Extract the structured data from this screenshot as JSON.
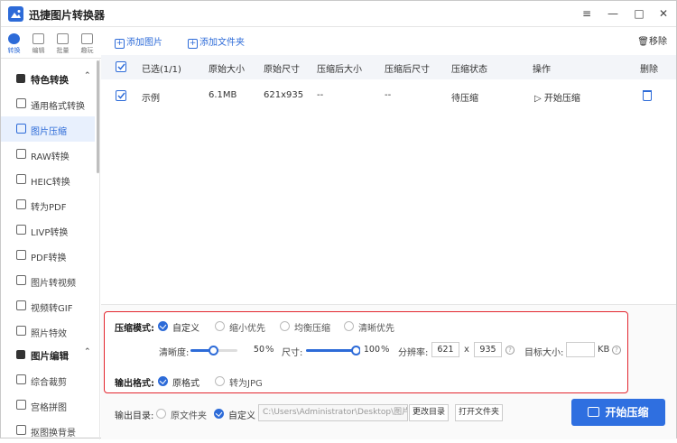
{
  "app": {
    "title": "迅捷图片转换器",
    "brand_color": "#2d6bd8"
  },
  "window_controls": {
    "menu": "≡",
    "minimize": "—",
    "maximize": "□",
    "close": "✕"
  },
  "nav_tabs": [
    {
      "label": "转换",
      "icon": "convert-icon",
      "active": true
    },
    {
      "label": "编辑",
      "icon": "edit-icon"
    },
    {
      "label": "批量",
      "icon": "batch-icon"
    },
    {
      "label": "趣玩",
      "icon": "fun-icon"
    }
  ],
  "sidebar": {
    "group1": {
      "label": "特色转换",
      "chevron": "⌃"
    },
    "items": [
      {
        "label": "通用格式转换"
      },
      {
        "label": "图片压缩",
        "active": true
      },
      {
        "label": "RAW转换"
      },
      {
        "label": "HEIC转换"
      },
      {
        "label": "转为PDF"
      },
      {
        "label": "LIVP转换"
      },
      {
        "label": "PDF转换"
      },
      {
        "label": "图片转视频"
      },
      {
        "label": "视频转GIF"
      },
      {
        "label": "照片特效"
      }
    ],
    "group2": {
      "label": "图片编辑",
      "chevron": "⌃"
    },
    "items2": [
      {
        "label": "综合裁剪"
      },
      {
        "label": "宫格拼图"
      },
      {
        "label": "抠图换背景"
      }
    ]
  },
  "toolbar": {
    "add_image": "添加图片",
    "add_folder": "添加文件夹",
    "remove": "移除"
  },
  "table": {
    "headers": [
      "已选(1/1)",
      "原始大小",
      "原始尺寸",
      "压缩后大小",
      "压缩后尺寸",
      "压缩状态",
      "操作",
      "删除"
    ],
    "rows": [
      {
        "name": "示例",
        "size": "6.1MB",
        "dims": "621x935",
        "new_size": "--",
        "new_dims": "--",
        "status": "待压缩",
        "action": "开始压缩"
      }
    ]
  },
  "compress": {
    "mode_label": "压缩模式:",
    "modes": [
      "自定义",
      "缩小优先",
      "均衡压缩",
      "清晰优先"
    ],
    "selected_mode": 0,
    "clarity_label": "清晰度:",
    "clarity_value": "50",
    "clarity_percent": 50,
    "percent_sign": "%",
    "size_label": "尺寸:",
    "size_value": "100",
    "size_percent": 100,
    "resolution_label": "分辨率:",
    "res_w": "621",
    "res_x": "x",
    "res_h": "935",
    "help": "?",
    "target_label": "目标大小:",
    "target_value": "",
    "target_unit": "KB",
    "format_label": "输出格式:",
    "formats": [
      "原格式",
      "转为JPG"
    ],
    "selected_format": 0
  },
  "output": {
    "label": "输出目录:",
    "options": [
      "原文件夹",
      "自定义"
    ],
    "selected": 1,
    "path": "C:\\Users\\Administrator\\Desktop\\图片",
    "change_dir": "更改目录",
    "open_folder": "打开文件夹"
  },
  "start_button": "开始压缩",
  "colors": {
    "accent": "#2d6bd8",
    "highlight_box": "#e3262e",
    "start_button": "#2f6fe0"
  }
}
